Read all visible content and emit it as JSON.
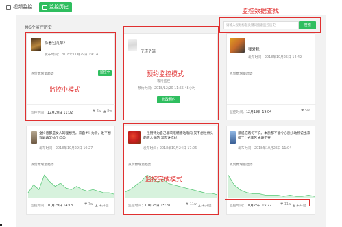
{
  "tabs": [
    {
      "label": "视频监控"
    },
    {
      "label": "监控历史"
    }
  ],
  "summary": {
    "count_text": "共6个监控历史"
  },
  "search": {
    "placeholder": "请输入视频标题关键词搜索监控历史",
    "button": "搜索",
    "annotation": "监控数据查找"
  },
  "cards": [
    {
      "title": "你看过几部？",
      "publish": "发布时间：2018年11月29日 19:14",
      "label": "点赞数增量趋势",
      "badge": "监控中",
      "footer_label": "监控时间：",
      "footer_value": "12月20日 11:02",
      "likes": "6w",
      "comments": "8w",
      "annotation": "监控中模式"
    },
    {
      "title": "子瑾子清",
      "status": "等待监控",
      "scheduled": "预约时间：2018/12/20 11:55  48小时",
      "button": "修改预约",
      "annotation": "预约监控模式"
    },
    {
      "title": "我爱我",
      "publish": "发布时间：2018年10月25日 14:42",
      "label": "点赞数增量趋势",
      "footer_label": "监控时间：",
      "footer_value": "12月19日 19:04",
      "likes": "5w"
    },
    {
      "title": "全抖音都是女人的理想男。来自#斗为云，谁不想我屏幕又帅了😎😍",
      "publish": "发布时间：2018年10月29日 10:27",
      "label": "点赞数增量趋势",
      "footer_label": "监控时间：",
      "footer_value": "10月29日 14:13",
      "likes": "7w",
      "comments": "未开启",
      "chart": [
        3,
        8,
        5,
        14,
        10,
        7,
        9,
        6,
        5,
        7,
        5,
        4,
        5,
        4,
        3,
        3,
        2
      ]
    },
    {
      "title": "一位厨师为自己喜欢吃糖醋咕噜肉 又不想吐骨头的客人做的 溜肉谁吃过",
      "publish": "发布时间：2018年10月24日 17:06",
      "label": "点赞数增量趋势",
      "footer_label": "监控时间：",
      "footer_value": "10月25日 15:28",
      "likes": "11w",
      "comments": "未开启",
      "chart": [
        4,
        6,
        9,
        12,
        16,
        14,
        11,
        13,
        10,
        9,
        8,
        7,
        6,
        5,
        4,
        3,
        3,
        2
      ],
      "annotation": "监控完成模式"
    },
    {
      "title": "都说这两句不说，本质都不能令心质小动物说出来都了！#非苦 #表不安",
      "publish": "发布时间：2018年10月25日 11:04",
      "label": "点赞数增量趋势",
      "footer_label": "监控时间：",
      "footer_value": "10月25日 15:22",
      "likes": "11w",
      "comments": "未开启",
      "chart": [
        18,
        10,
        6,
        4,
        3,
        3,
        2,
        2,
        2,
        1,
        2,
        1,
        1,
        2,
        1
      ]
    }
  ],
  "colors": {
    "accent": "#2fbe5f",
    "annotation": "#e03030"
  }
}
